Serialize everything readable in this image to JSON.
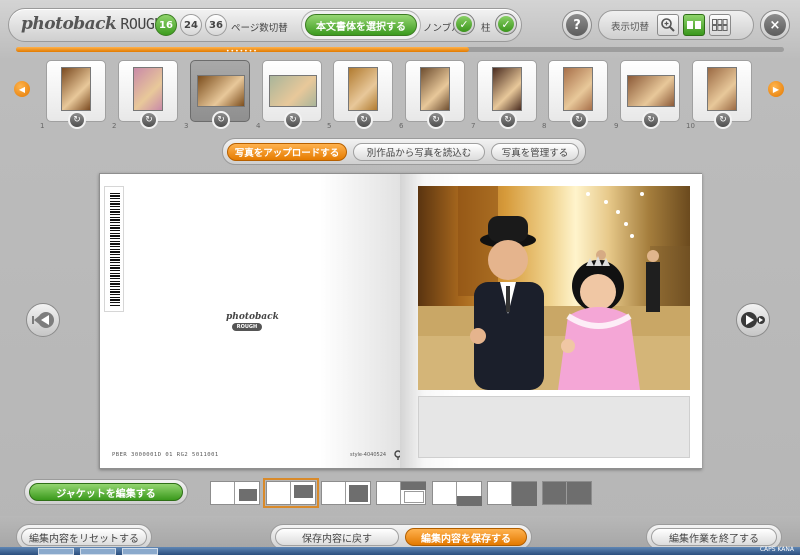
{
  "app": {
    "logo_text": "photoback",
    "logo_sub": "ROUGH"
  },
  "toolbar": {
    "page_counts": [
      "16",
      "24",
      "36"
    ],
    "active_page_count": "16",
    "page_count_label": "ページ数切替",
    "font_button": "本文書体を選択する",
    "nombre_label": "ノンブル",
    "pillar_label": "柱",
    "help_label": "?",
    "view_label": "表示切替",
    "close_label": "×"
  },
  "progress": {
    "value_pct": 59,
    "dots": "•••••••"
  },
  "thumbnails": [
    {
      "num": "1",
      "selected": false
    },
    {
      "num": "2",
      "selected": false
    },
    {
      "num": "3",
      "selected": true
    },
    {
      "num": "4",
      "selected": false
    },
    {
      "num": "5",
      "selected": false
    },
    {
      "num": "6",
      "selected": false
    },
    {
      "num": "7",
      "selected": false
    },
    {
      "num": "8",
      "selected": false
    },
    {
      "num": "9",
      "selected": false
    },
    {
      "num": "10",
      "selected": false
    }
  ],
  "upload": {
    "upload_photo": "写真をアップロードする",
    "load_other": "別作品から写真を読込む",
    "manage_photo": "写真を管理する"
  },
  "book": {
    "mini_logo": "photoback",
    "mini_logo_sub": "ROUGH",
    "footer_code": "PBER 3000001D 01 RG2 5011001",
    "style_code": "style-4040524"
  },
  "layouts": {
    "jacket_button": "ジャケットを編集する",
    "selected_index": 1
  },
  "footer": {
    "reset": "編集内容をリセットする",
    "restore": "保存内容に戻す",
    "save": "編集内容を保存する",
    "finish": "編集作業を終了する"
  },
  "taskbar": {
    "tray": "CAPS KANA"
  },
  "colors": {
    "accent_green": "#3d9c1f",
    "accent_orange": "#e37900",
    "selected_outline": "#d98a2a"
  }
}
